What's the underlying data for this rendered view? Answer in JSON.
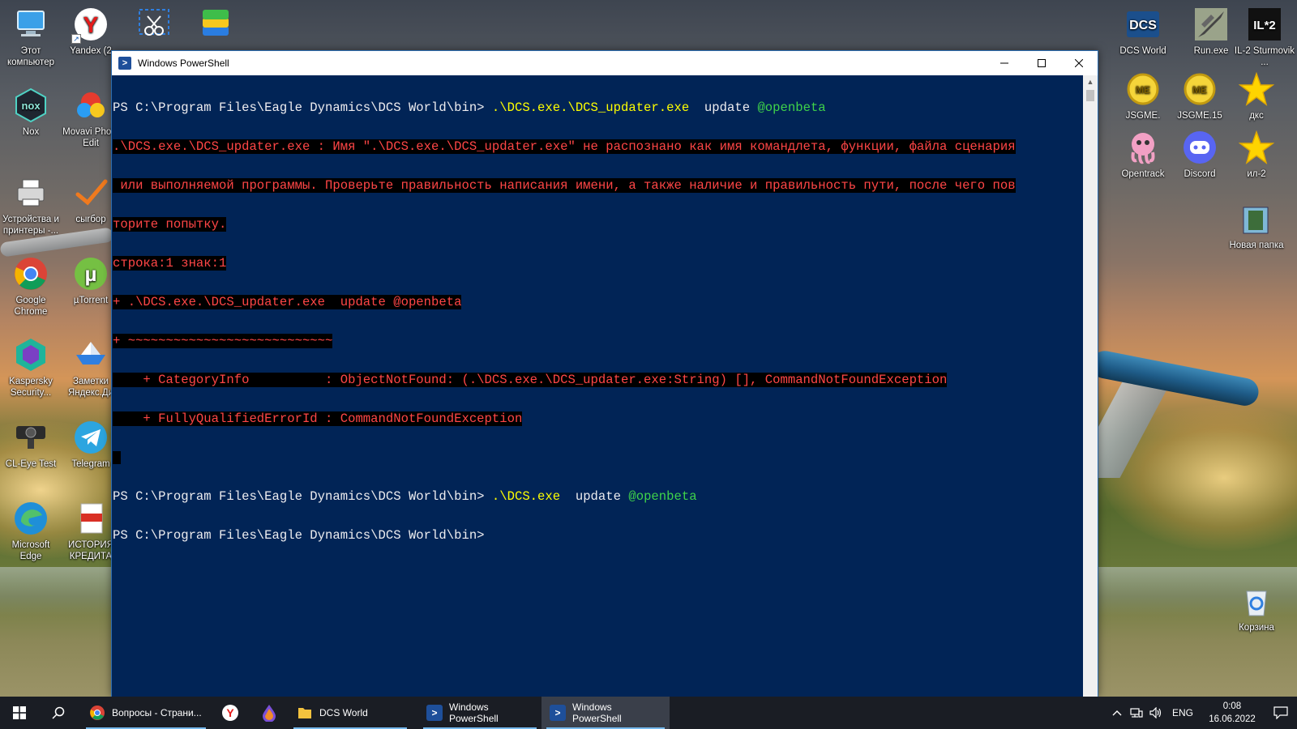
{
  "desktop": {
    "left_icons": [
      {
        "label": "Этот компьютер"
      },
      {
        "label": "Yandex (2"
      },
      {
        "label": ""
      },
      {
        "label": ""
      },
      {
        "label": "Nox"
      },
      {
        "label": "Movavi Photo Edit"
      },
      {
        "label": "Устройства и принтеры -..."
      },
      {
        "label": "сыrбор"
      },
      {
        "label": "Google Chrome"
      },
      {
        "label": "µTorrent"
      },
      {
        "label": "Kaspersky Security..."
      },
      {
        "label": "Заметки Яндекс.Ди"
      },
      {
        "label": "CL-Eye Test"
      },
      {
        "label": "Telegram"
      },
      {
        "label": "Microsoft Edge"
      },
      {
        "label": "ИСТОРИЯ КРЕДИТА"
      }
    ],
    "right_icons": [
      {
        "label": "DCS World"
      },
      {
        "label": "Run.exe"
      },
      {
        "label": "IL-2 Sturmovik ..."
      },
      {
        "label": "JSGME."
      },
      {
        "label": "JSGME.15"
      },
      {
        "label": "дкс"
      },
      {
        "label": "Opentrack"
      },
      {
        "label": "Discord"
      },
      {
        "label": "ил-2"
      },
      {
        "label": "Новая папка"
      },
      {
        "label": "Корзина"
      }
    ]
  },
  "window": {
    "title": "Windows PowerShell",
    "console": {
      "prompt1": "PS C:\\Program Files\\Eagle Dynamics\\DCS World\\bin> ",
      "cmd1": ".\\DCS.exe.\\DCS_updater.exe",
      "cmd1_args": "  update ",
      "cmd1_param": "@openbeta",
      "err_line1": ".\\DCS.exe.\\DCS_updater.exe : Имя \".\\DCS.exe.\\DCS_updater.exe\" не распознано как имя командлета, функции, файла сценария",
      "err_line2": " или выполняемой программы. Проверьте правильность написания имени, а также наличие и правильность пути, после чего пов",
      "err_line3": "торите попытку.",
      "err_line4": "строка:1 знак:1",
      "err_line5": "+ .\\DCS.exe.\\DCS_updater.exe  update @openbeta",
      "err_line6": "+ ~~~~~~~~~~~~~~~~~~~~~~~~~~~",
      "err_line7": "    + CategoryInfo          : ObjectNotFound: (.\\DCS.exe.\\DCS_updater.exe:String) [], CommandNotFoundException",
      "err_line8": "    + FullyQualifiedErrorId : CommandNotFoundException",
      "prompt2": "PS C:\\Program Files\\Eagle Dynamics\\DCS World\\bin> ",
      "cmd2": ".\\DCS.exe",
      "cmd2_args": "  update ",
      "cmd2_param": "@openbeta",
      "prompt3": "PS C:\\Program Files\\Eagle Dynamics\\DCS World\\bin>"
    }
  },
  "taskbar": {
    "items": [
      {
        "label": "Вопросы - Страни...",
        "icon": "chrome-icon"
      },
      {
        "label": "",
        "icon": "yandex-icon"
      },
      {
        "label": "",
        "icon": "drop-icon"
      },
      {
        "label": "DCS World",
        "icon": "folder-icon"
      },
      {
        "label": "Windows PowerShell",
        "icon": "powershell-icon"
      },
      {
        "label": "Windows PowerShell",
        "icon": "powershell-icon"
      }
    ],
    "tray": {
      "language": "ENG",
      "time": "0:08",
      "date": "16.06.2022"
    }
  },
  "colors": {
    "console_bg": "#012456",
    "console_text": "#eeedf0",
    "error_text": "#ff4646",
    "command_yellow": "#ffff00",
    "parameter_green": "#3fd34a",
    "taskbar_bg": "#1a1d24",
    "taskbar_accent": "#76b9ed"
  }
}
